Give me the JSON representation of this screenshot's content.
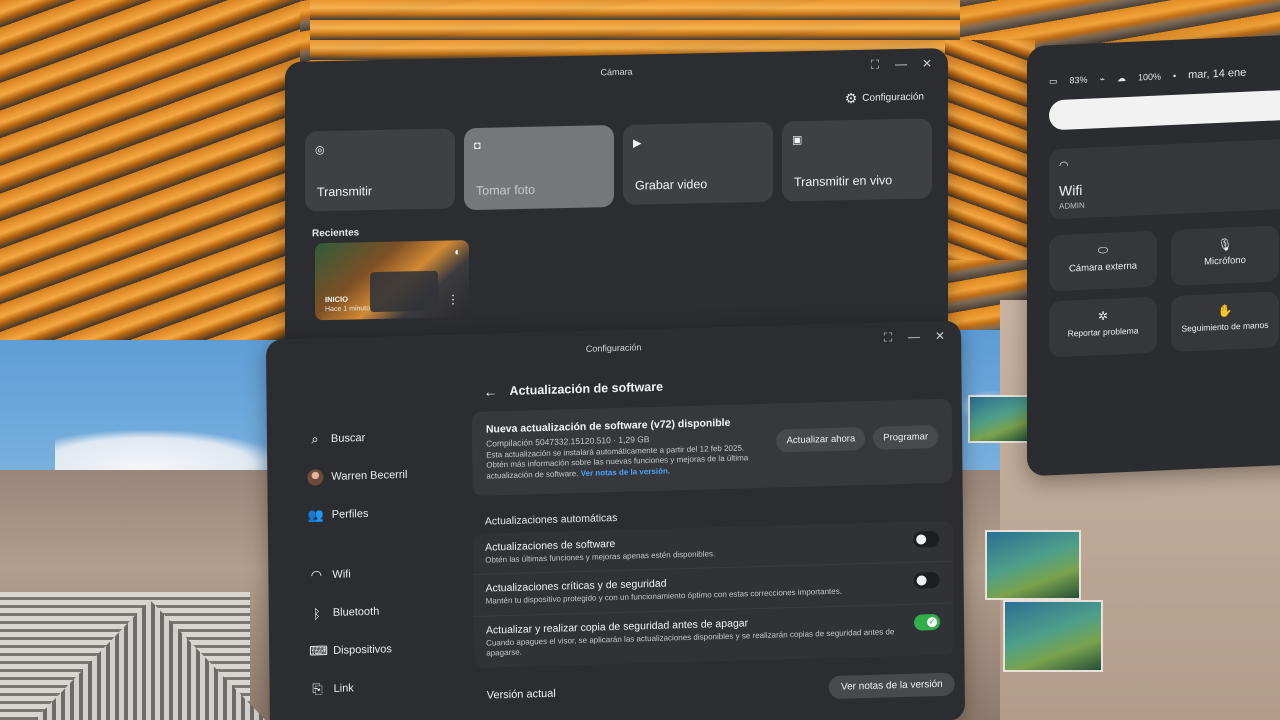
{
  "camera": {
    "title": "Cámara",
    "config_label": "Configuración",
    "cards": [
      {
        "icon": "transmit-icon",
        "label": "Transmitir"
      },
      {
        "icon": "camera-icon",
        "label": "Tomar foto"
      },
      {
        "icon": "video-icon",
        "label": "Grabar video"
      },
      {
        "icon": "live-icon",
        "label": "Transmitir en vivo"
      }
    ],
    "recent_title": "Recientes",
    "recent_item": {
      "title": "INICIO",
      "subtitle": "Hace 1 minuto"
    }
  },
  "quick": {
    "battery": "83%",
    "controller_battery": "100%",
    "date": "mar, 14 ene",
    "wifi_title": "Wifi",
    "wifi_network": "ADMIN",
    "tiles": [
      "Cámara externa",
      "Micrófono",
      "Reportar problema",
      "Seguimiento de manos"
    ]
  },
  "settings": {
    "title": "Configuración",
    "sidebar": [
      {
        "icon": "search-icon",
        "label": "Buscar"
      },
      {
        "icon": "avatar",
        "label": "Warren Becerril"
      },
      {
        "icon": "profiles-icon",
        "label": "Perfiles"
      },
      {
        "icon": "wifi-icon",
        "label": "Wifi"
      },
      {
        "icon": "bluetooth-icon",
        "label": "Bluetooth"
      },
      {
        "icon": "devices-icon",
        "label": "Dispositivos"
      },
      {
        "icon": "link-icon",
        "label": "Link"
      }
    ],
    "page_title": "Actualización de software",
    "update": {
      "heading": "Nueva actualización de software (v72) disponible",
      "meta": "Compilación 5047332.15120.510 · 1,29 GB",
      "desc": "Esta actualización se instalará automáticamente a partir del 12 feb 2025. Obtén más información sobre las nuevas funciones y mejoras de la última actualización de software.",
      "link": "Ver notas de la versión.",
      "btn_update": "Actualizar ahora",
      "btn_schedule": "Programar"
    },
    "auto_section": "Actualizaciones automáticas",
    "toggles": [
      {
        "title": "Actualizaciones de software",
        "desc": "Obtén las últimas funciones y mejoras apenas estén disponibles.",
        "on": false
      },
      {
        "title": "Actualizaciones críticas y de seguridad",
        "desc": "Mantén tu dispositivo protegido y con un funcionamiento óptimo con estas correcciones importantes.",
        "on": false
      },
      {
        "title": "Actualizar y realizar copia de seguridad antes de apagar",
        "desc": "Cuando apagues el visor, se aplicarán las actualizaciones disponibles y se realizarán copias de seguridad antes de apagarse.",
        "on": true
      }
    ],
    "version_label": "Versión actual",
    "version_btn": "Ver notas de la versión"
  }
}
